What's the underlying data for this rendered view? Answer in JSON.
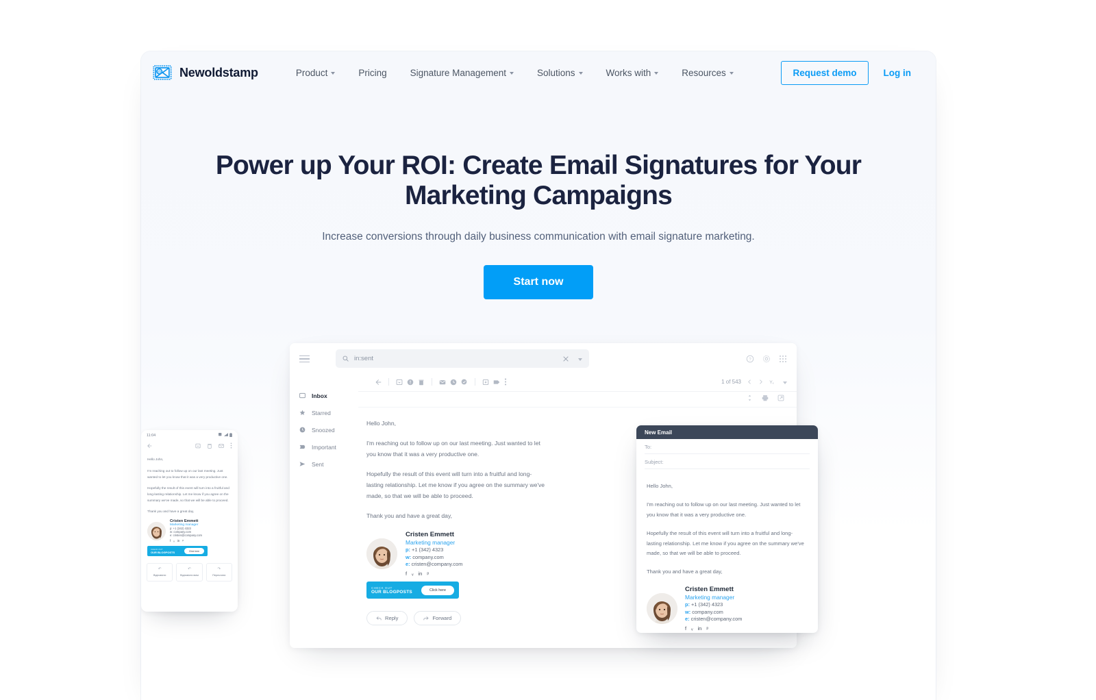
{
  "brand": {
    "name": "Newoldstamp",
    "logo_icon": "envelope-at-icon",
    "accent": "#0a9bf5"
  },
  "nav": {
    "items": [
      {
        "label": "Product",
        "has_caret": true
      },
      {
        "label": "Pricing",
        "has_caret": false
      },
      {
        "label": "Signature Management",
        "has_caret": true
      },
      {
        "label": "Solutions",
        "has_caret": true
      },
      {
        "label": "Works with",
        "has_caret": true
      },
      {
        "label": "Resources",
        "has_caret": true
      }
    ],
    "request_demo": "Request demo",
    "log_in": "Log in"
  },
  "hero": {
    "title": "Power up Your ROI: Create Email Signatures for Your Marketing Campaigns",
    "subtitle": "Increase conversions through daily business communication with email signature marketing.",
    "cta": "Start now",
    "title_color": "#1b2340",
    "cta_color": "#029ef7"
  },
  "gmail": {
    "search_value": "in:sent",
    "search_icon": "search-icon",
    "clear_icon": "close-icon",
    "pagination": "1 of 543",
    "sidebar": [
      {
        "label": "Inbox",
        "icon": "inbox-icon",
        "active": true
      },
      {
        "label": "Starred",
        "icon": "star-icon",
        "active": false
      },
      {
        "label": "Snoozed",
        "icon": "clock-icon",
        "active": false
      },
      {
        "label": "Important",
        "icon": "important-icon",
        "active": false
      },
      {
        "label": "Sent",
        "icon": "send-icon",
        "active": false
      }
    ],
    "mail": {
      "greeting": "Hello John,",
      "p1": "I'm reaching out to follow up on our last meeting. Just wanted to let you know that it was a very productive one.",
      "p2": "Hopefully the result of this event will turn into a fruitful and long-lasting relationship. Let me know if you agree on the summary we've made, so that we will be able to proceed.",
      "p3": "Thank you and have a great day,"
    },
    "reply": "Reply",
    "forward": "Forward"
  },
  "signature": {
    "name": "Cristen Emmett",
    "role": "Marketing manager",
    "phone_label": "p:",
    "phone": "+1 (342) 4323",
    "web_label": "w:",
    "web": "company.com",
    "email_label": "e:",
    "email": "cristen@company.com",
    "socials": [
      "facebook-icon",
      "twitter-icon",
      "linkedin-icon",
      "pinterest-icon"
    ],
    "banner_line1": "CHECK OUT",
    "banner_line2": "OUR BLOGPOSTS",
    "banner_button": "Click here",
    "banner_color": "#16ace3"
  },
  "new_email": {
    "title": "New Email",
    "to_label": "To:",
    "subject_label": "Subject:",
    "header_color": "#3c4759"
  },
  "phone": {
    "time": "11:04",
    "reply": "Відповісти",
    "reply_all": "Відповісти всім",
    "forward": "Переслати"
  }
}
